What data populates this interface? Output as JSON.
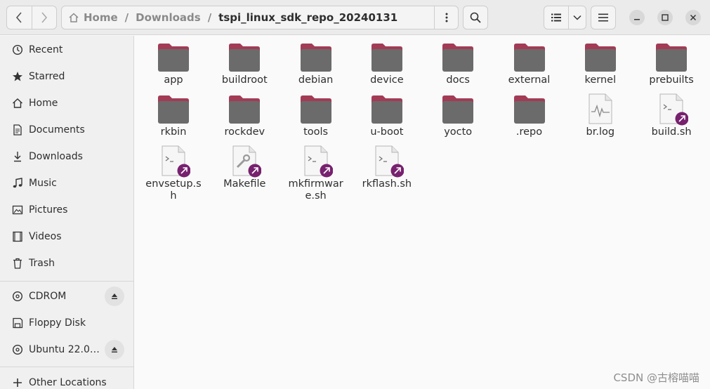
{
  "pathbar": {
    "crumbs": [
      "Home",
      "Downloads",
      "tspi_linux_sdk_repo_20240131"
    ],
    "separator": "/"
  },
  "sidebar": {
    "items": [
      {
        "label": "Recent",
        "icon": "clock-icon"
      },
      {
        "label": "Starred",
        "icon": "star-icon"
      },
      {
        "label": "Home",
        "icon": "home-icon"
      },
      {
        "label": "Documents",
        "icon": "document-icon"
      },
      {
        "label": "Downloads",
        "icon": "download-icon"
      },
      {
        "label": "Music",
        "icon": "music-icon"
      },
      {
        "label": "Pictures",
        "icon": "picture-icon"
      },
      {
        "label": "Videos",
        "icon": "video-icon"
      },
      {
        "label": "Trash",
        "icon": "trash-icon"
      }
    ],
    "devices": [
      {
        "label": "CDROM",
        "icon": "disc-icon",
        "eject": true
      },
      {
        "label": "Floppy Disk",
        "icon": "floppy-icon",
        "eject": false
      },
      {
        "label": "Ubuntu 22.0…",
        "icon": "disc-icon",
        "eject": true
      }
    ],
    "other": {
      "label": "Other Locations",
      "icon": "plus-icon"
    }
  },
  "files": [
    {
      "name": "app",
      "type": "folder"
    },
    {
      "name": "buildroot",
      "type": "folder"
    },
    {
      "name": "debian",
      "type": "folder"
    },
    {
      "name": "device",
      "type": "folder"
    },
    {
      "name": "docs",
      "type": "folder"
    },
    {
      "name": "external",
      "type": "folder"
    },
    {
      "name": "kernel",
      "type": "folder"
    },
    {
      "name": "prebuilts",
      "type": "folder"
    },
    {
      "name": "rkbin",
      "type": "folder"
    },
    {
      "name": "rockdev",
      "type": "folder"
    },
    {
      "name": "tools",
      "type": "folder"
    },
    {
      "name": "u-boot",
      "type": "folder"
    },
    {
      "name": "yocto",
      "type": "folder"
    },
    {
      "name": ".repo",
      "type": "folder"
    },
    {
      "name": "br.log",
      "type": "log"
    },
    {
      "name": "build.sh",
      "type": "script-link"
    },
    {
      "name": "envsetup.sh",
      "type": "script-link"
    },
    {
      "name": "Makefile",
      "type": "makefile-link"
    },
    {
      "name": "mkfirmware.sh",
      "type": "script-link"
    },
    {
      "name": "rkflash.sh",
      "type": "script-link"
    }
  ],
  "colors": {
    "folder_tab": "#a33b55",
    "folder_body": "#6b6b6b",
    "link_badge": "#77216f"
  },
  "watermark": "CSDN @古榕喵喵"
}
